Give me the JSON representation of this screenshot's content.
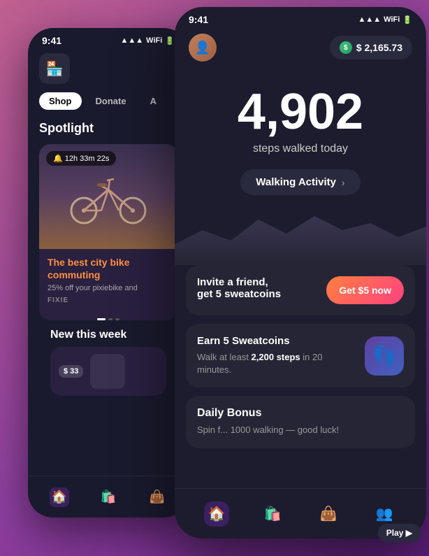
{
  "back_phone": {
    "status_time": "9:41",
    "app_icon": "🏪",
    "tabs": [
      {
        "label": "Shop",
        "active": true
      },
      {
        "label": "Donate",
        "active": false
      },
      {
        "label": "A",
        "active": false
      }
    ],
    "spotlight_title": "Spotlight",
    "card": {
      "timer": "🔔 12h 33m 22s",
      "title": "The best city bike commuting",
      "subtitle": "25% off your pixiebike and",
      "brand": "FIXIE"
    },
    "new_this_week": "New this week",
    "new_card_price": "$ 33"
  },
  "front_phone": {
    "status_time": "9:41",
    "balance": "$ 2,165.73",
    "steps_count": "4,902",
    "steps_label": "steps walked today",
    "walking_activity": "Walking Activity",
    "invite_card": {
      "title": "Invite a friend,",
      "subtitle": "get 5 sweatcoins",
      "button": "Get $5 now"
    },
    "earn_card": {
      "title": "Earn 5 Sweatcoins",
      "description_start": "Walk at least ",
      "steps_bold": "2,200 steps",
      "description_end": " in 20 minutes."
    },
    "daily_card": {
      "title": "Daily Bonus",
      "description": "Spin f... 1000 walking — good luck!"
    },
    "play_btn": "Play ▶"
  },
  "icons": {
    "home": "🏠",
    "shop": "🛍️",
    "wallet": "👜",
    "people": "👥",
    "footprints": "👣"
  }
}
